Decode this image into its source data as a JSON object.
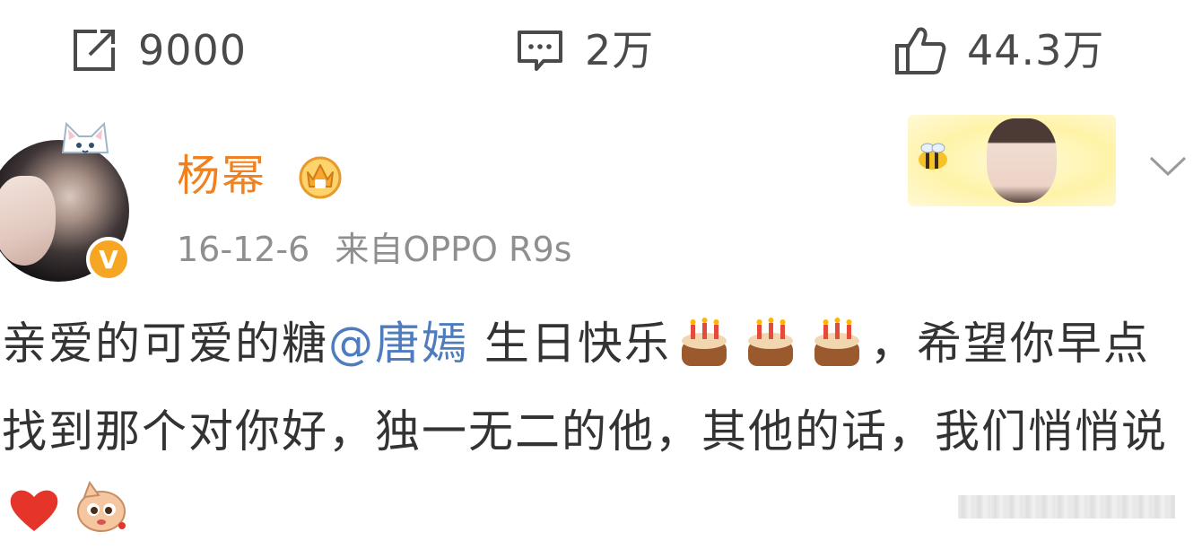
{
  "actions": {
    "forward_count": "9000",
    "comment_count": "2万",
    "like_count": "44.3万"
  },
  "post": {
    "username": "杨幂",
    "date": "16-12-6",
    "source": "来自OPPO R9s",
    "text_part1": "亲爱的可爱的糖",
    "mention": "@唐嫣",
    "text_part2": " 生日快乐",
    "text_part3": "，希望你早点找到那个对你好，独一无二的他，其他的话，我们悄悄说",
    "verified_badge": "V"
  },
  "colors": {
    "username": "#f0811f",
    "mention": "#4e7cbd",
    "meta": "#8f8f8f",
    "icon": "#4a4a4a",
    "badge": "#f6a623"
  },
  "icons": [
    "forward-icon",
    "comment-icon",
    "like-icon",
    "vip-crown-icon",
    "verified-badge",
    "chevron-down-icon",
    "cake-icon",
    "heart-icon",
    "sticker-icon"
  ]
}
